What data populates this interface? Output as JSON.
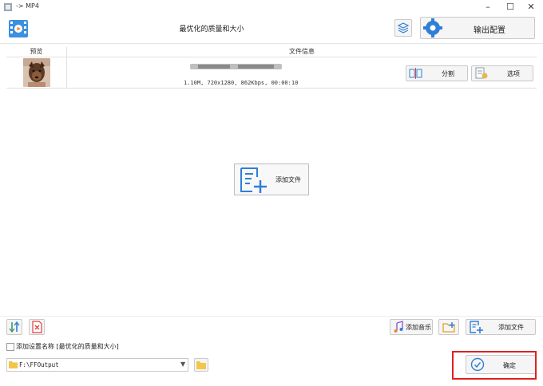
{
  "window": {
    "title": "-> MP4",
    "controls": [
      "minimize",
      "maximize",
      "close"
    ]
  },
  "toolbar": {
    "profile": "最优化的质量和大小",
    "output_settings_label": "输出配置"
  },
  "table": {
    "headers": [
      "预览",
      "文件信息"
    ],
    "rows": [
      {
        "file_name": "████████████.mp4",
        "file_info": "1.10M, 720x1280, 862Kbps, 00:00:10",
        "split_label": "分割",
        "options_label": "选项"
      }
    ]
  },
  "center": {
    "add_file_label": "添加文件"
  },
  "bottom": {
    "add_music_label": "添加音乐",
    "add_file_label": "添加文件",
    "checkbox_label": "添加设置名称 [最优化的质量和大小]",
    "checkbox_checked": false,
    "output_path": "F:\\FFOutput",
    "ok_label": "确定"
  },
  "colors": {
    "accent_blue": "#2f7fd6",
    "highlight_red": "#e02020"
  },
  "icons": [
    "format-video-icon",
    "layers-icon",
    "gear-icon",
    "split-icon",
    "options-icon",
    "add-file-icon",
    "sort-icon",
    "delete-icon",
    "music-icon",
    "folder-add-icon",
    "folder-icon",
    "check-circle-icon",
    "dropdown-arrow-icon"
  ]
}
